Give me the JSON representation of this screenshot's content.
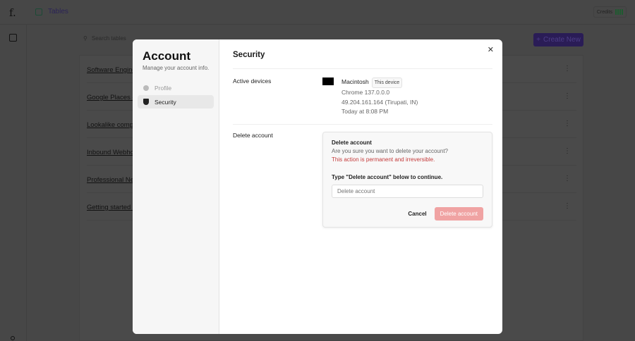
{
  "app": {
    "logo": "f.",
    "tab": "Tables",
    "credits": "Credits"
  },
  "toolbar": {
    "search_placeholder": "Search tables",
    "create_label": "Create New"
  },
  "tables": [
    "Software Engineers",
    "Google Places - ",
    "Lookalike companies",
    "Inbound Webhooks",
    "Professional Network",
    "Getting started with"
  ],
  "modal": {
    "title": "Account",
    "subtitle": "Manage your account info.",
    "nav": [
      {
        "label": "Profile"
      },
      {
        "label": "Security"
      }
    ],
    "section_title": "Security",
    "active_devices_label": "Active devices",
    "device": {
      "name": "Macintosh",
      "badge": "This device",
      "browser": "Chrome 137.0.0.0",
      "ip": "49.204.161.164 (Tirupati, IN)",
      "time": "Today at 8:08 PM"
    },
    "delete_label": "Delete account",
    "confirm": {
      "title": "Delete account",
      "question": "Are you sure you want to delete your account?",
      "warning": "This action is permanent and irreversible.",
      "instruction": "Type \"Delete account\" below to continue.",
      "placeholder": "Delete account",
      "cancel": "Cancel",
      "delete": "Delete account"
    }
  }
}
